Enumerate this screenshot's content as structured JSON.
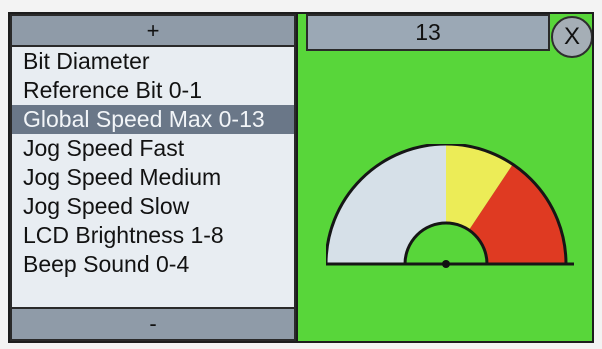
{
  "controls": {
    "plus_label": "+",
    "minus_label": "-"
  },
  "menu": {
    "items": [
      "Bit Diameter",
      "Reference Bit 0-1",
      "Global Speed Max 0-13",
      "Jog Speed Fast",
      "Jog Speed Medium",
      "Jog Speed Slow",
      "LCD Brightness 1-8",
      "Beep Sound 0-4"
    ],
    "selected_index": 2
  },
  "setting": {
    "value": "13",
    "close_label": "X"
  },
  "gauge": {
    "segment_colors": {
      "low": "#d6e0e8",
      "mid": "#ecec57",
      "high": "#df3a22",
      "hub": "#58d63a",
      "outline": "#161616"
    }
  },
  "colors": {
    "panel_green": "#58d63a",
    "button_gray": "#8f9ba8",
    "selected_row": "#6a7788"
  }
}
